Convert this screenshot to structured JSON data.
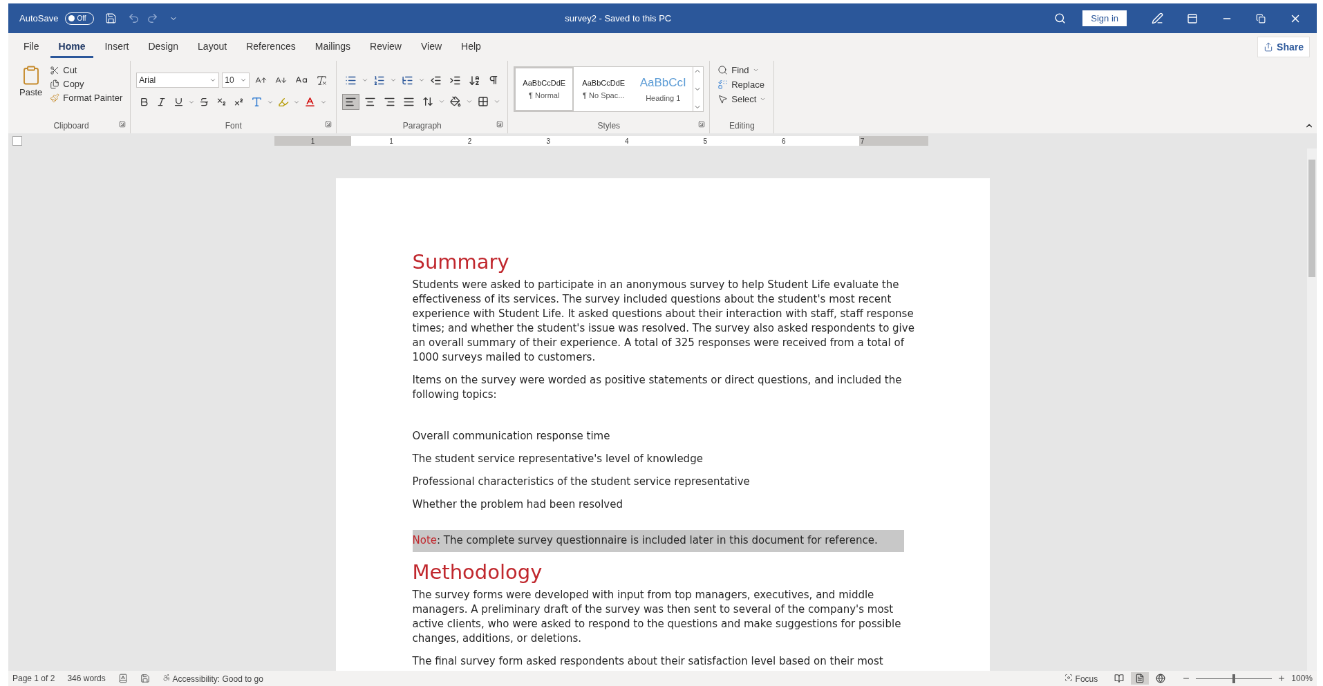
{
  "title_bar": {
    "autosave_label": "AutoSave",
    "autosave": {
      "label": "Off",
      "on": false
    },
    "title": "survey2 - Saved to this PC",
    "sign_in": "Sign in"
  },
  "tabs": [
    {
      "label": "File",
      "selected": false
    },
    {
      "label": "Home",
      "selected": true
    },
    {
      "label": "Insert",
      "selected": false
    },
    {
      "label": "Design",
      "selected": false
    },
    {
      "label": "Layout",
      "selected": false
    },
    {
      "label": "References",
      "selected": false
    },
    {
      "label": "Mailings",
      "selected": false
    },
    {
      "label": "Review",
      "selected": false
    },
    {
      "label": "View",
      "selected": false
    },
    {
      "label": "Help",
      "selected": false
    }
  ],
  "share": "Share",
  "ribbon": {
    "clipboard": {
      "paste": "Paste",
      "cut": "Cut",
      "copy": "Copy",
      "format_painter": "Format Painter",
      "label": "Clipboard"
    },
    "font": {
      "name": "Arial",
      "size": "10",
      "label": "Font"
    },
    "paragraph": {
      "label": "Paragraph",
      "alignment": [
        {
          "kind": "left",
          "selected": true
        },
        {
          "kind": "center",
          "selected": false
        },
        {
          "kind": "right",
          "selected": false
        },
        {
          "kind": "justify",
          "selected": false
        }
      ]
    },
    "styles": {
      "label": "Styles",
      "items": [
        {
          "preview": "AaBbCcDdE",
          "name": "¶ Normal",
          "kind": "body",
          "selected": true
        },
        {
          "preview": "AaBbCcDdE",
          "name": "¶ No Spac...",
          "kind": "body",
          "selected": false
        },
        {
          "preview": "AaBbCcI",
          "name": "Heading 1",
          "kind": "heading",
          "selected": false
        }
      ]
    },
    "editing": {
      "label": "Editing",
      "find": "Find",
      "replace": "Replace",
      "select": "Select"
    }
  },
  "ruler": [
    "1",
    "1",
    "2",
    "3",
    "4",
    "5",
    "6",
    "7"
  ],
  "document": [
    {
      "kind": "heading",
      "text": "Summary"
    },
    {
      "kind": "paragraph",
      "text": "Students were asked to participate in an anonymous survey to help Student Life evaluate the effectiveness of its services. The survey included questions about the student's most recent experience with Student Life.  It asked questions about their interaction with staff, staff response times; and whether the student's issue was resolved. The survey also asked respondents to give an overall summary of their experience. A total of 325 responses were received from a total of 1000 surveys mailed to customers."
    },
    {
      "kind": "paragraph",
      "text": "Items on the survey were worded as positive statements or direct questions, and included the following topics:"
    },
    {
      "kind": "topic",
      "text": "Overall communication response time"
    },
    {
      "kind": "topic",
      "text": "The student service representative's level of knowledge"
    },
    {
      "kind": "topic",
      "text": "Professional characteristics of the student service representative"
    },
    {
      "kind": "topic",
      "text": "Whether the problem had been resolved"
    },
    {
      "kind": "note",
      "label": "Note",
      "text": ": The complete survey questionnaire is included later in this document for reference."
    },
    {
      "kind": "heading",
      "text": "Methodology"
    },
    {
      "kind": "paragraph",
      "text": "The survey forms were developed with input from top managers, executives, and middle managers. A preliminary draft of the survey was then sent to several of the company's most active clients, who were asked to respond to the questions and make suggestions for possible changes, additions, or deletions."
    },
    {
      "kind": "paragraph",
      "text": "The final survey form asked respondents about their satisfaction level based on their most"
    }
  ],
  "status_bar": {
    "page": "Page 1 of 2",
    "words": "346 words",
    "accessibility": "Accessibility: Good to go",
    "focus": "Focus",
    "views": [
      {
        "kind": "read",
        "selected": false
      },
      {
        "kind": "print",
        "selected": true
      },
      {
        "kind": "web",
        "selected": false
      }
    ],
    "zoom": {
      "level": 0.5,
      "reading": "100%"
    }
  }
}
